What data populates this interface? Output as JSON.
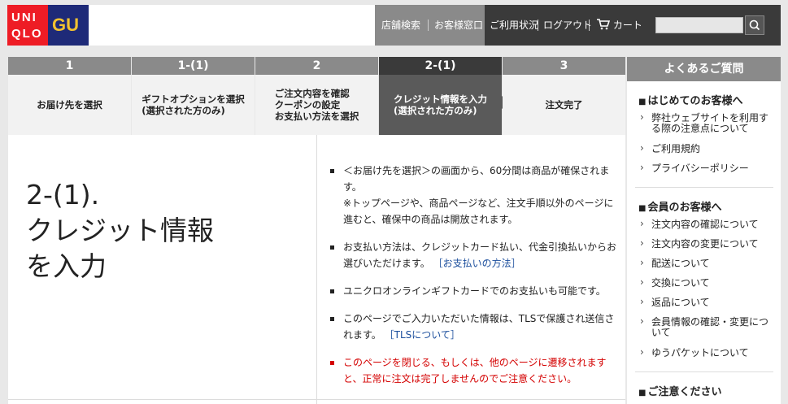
{
  "header": {
    "logo_uniqlo_line1": "UNI",
    "logo_uniqlo_line2": "QLO",
    "logo_gu": "GU",
    "nav": [
      "店舗検索",
      "お客様窓口",
      "ご利用状況",
      "ログアウト",
      "カート"
    ],
    "search_placeholder": ""
  },
  "steps": [
    {
      "num": "1",
      "label": "お届け先を選択"
    },
    {
      "num": "1-(1)",
      "label": "ギフトオプションを選択\n(選択された方のみ)"
    },
    {
      "num": "2",
      "label": "ご注文内容を確認\nクーポンの設定\nお支払い方法を選択"
    },
    {
      "num": "2-(1)",
      "label": "クレジット情報を入力\n(選択された方のみ)"
    },
    {
      "num": "3",
      "label": "注文完了"
    }
  ],
  "main": {
    "title": "2-(1).\nクレジット情報\nを入力",
    "notes": {
      "n1a": "＜お届け先を選択＞の画面から、60分間は商品が確保されます。",
      "n1b": "※トップページや、商品ページなど、注文手順以外のページに進むと、確保中の商品は開放されます。",
      "n2": "お支払い方法は、クレジットカード払い、代金引換払いからお選びいただけます。",
      "n2_link": "［お支払いの方法］",
      "n3": "ユニクロオンラインギフトカードでのお支払いも可能です。",
      "n4": "このページでご入力いただいた情報は、TLSで保護され送信されます。",
      "n4_link": "［TLSについて］",
      "n5": "このページを閉じる、もしくは、他のページに遷移されますと、正常に注文は完了しませんのでご注意ください。"
    }
  },
  "faq": {
    "title": "よくあるご質問",
    "sections": [
      {
        "title": "はじめてのお客様へ",
        "items": [
          "弊社ウェブサイトを利用する際の注意点について",
          "ご利用規約",
          "プライバシーポリシー"
        ]
      },
      {
        "title": "会員のお客様へ",
        "items": [
          "注文内容の確認について",
          "注文内容の変更について",
          "配送について",
          "交換について",
          "返品について",
          "会員情報の確認・変更について",
          "ゆうパケットについて"
        ]
      },
      {
        "title": "ご注意ください",
        "items": []
      }
    ]
  },
  "colors": {
    "uniqlo_red": "#ee1c25",
    "gu_navy": "#1e2a78",
    "active_step": "#5a5a5a",
    "warning_red": "#d40000",
    "link_blue": "#1a4d9c"
  }
}
